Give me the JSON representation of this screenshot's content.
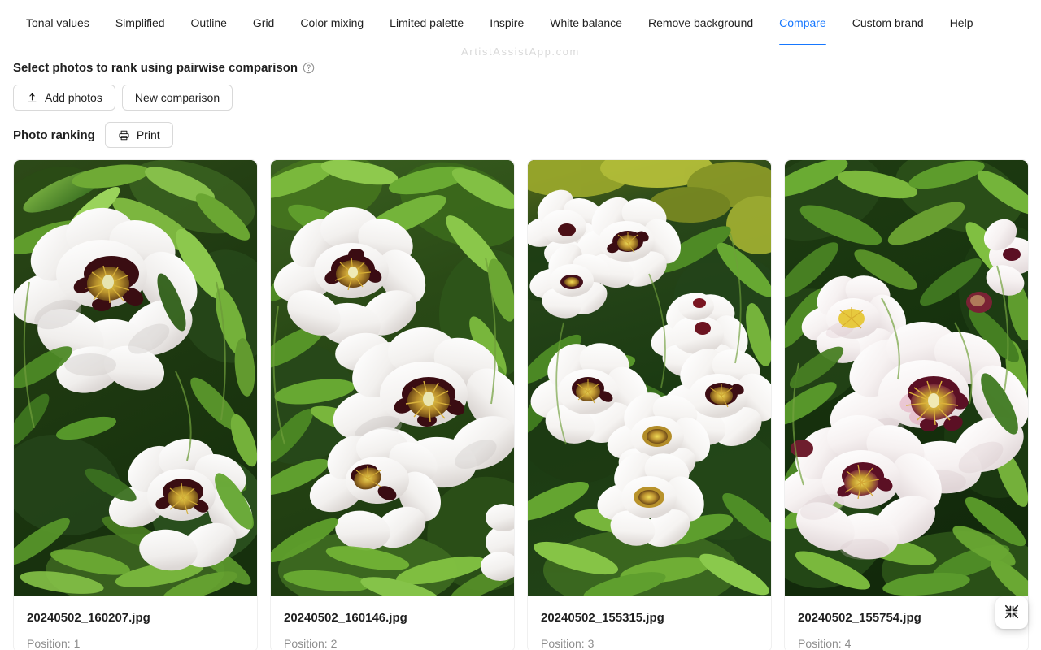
{
  "tabs": [
    {
      "label": "Tonal values",
      "active": false
    },
    {
      "label": "Simplified",
      "active": false
    },
    {
      "label": "Outline",
      "active": false
    },
    {
      "label": "Grid",
      "active": false
    },
    {
      "label": "Color mixing",
      "active": false
    },
    {
      "label": "Limited palette",
      "active": false
    },
    {
      "label": "Inspire",
      "active": false
    },
    {
      "label": "White balance",
      "active": false
    },
    {
      "label": "Remove background",
      "active": false
    },
    {
      "label": "Compare",
      "active": true
    },
    {
      "label": "Custom brand",
      "active": false
    },
    {
      "label": "Help",
      "active": false
    }
  ],
  "watermark": "ArtistAssistApp.com",
  "section": {
    "title": "Select photos to rank using pairwise comparison",
    "help_icon": "question-circle-icon"
  },
  "toolbar": {
    "add_photos_label": "Add photos",
    "add_photos_icon": "upload-icon",
    "new_comparison_label": "New comparison"
  },
  "ranking": {
    "label": "Photo ranking",
    "print_label": "Print",
    "print_icon": "printer-icon"
  },
  "fab": {
    "icon": "compress-icon",
    "label": "Exit fullscreen"
  },
  "colors": {
    "accent": "#1677ff",
    "text_primary": "rgba(0,0,0,0.88)",
    "text_secondary": "rgba(0,0,0,0.45)",
    "border": "#f0f0f0",
    "watermark": "#d9d9d9"
  },
  "photos": [
    {
      "filename": "20240502_160207.jpg",
      "position_label": "Position: 1",
      "scene": "white-peony-flowers-in-green-foliage"
    },
    {
      "filename": "20240502_160146.jpg",
      "position_label": "Position: 2",
      "scene": "white-peony-flowers-in-green-foliage"
    },
    {
      "filename": "20240502_155315.jpg",
      "position_label": "Position: 3",
      "scene": "white-peony-flowers-in-green-foliage"
    },
    {
      "filename": "20240502_155754.jpg",
      "position_label": "Position: 4",
      "scene": "white-peony-flowers-in-green-foliage"
    }
  ]
}
